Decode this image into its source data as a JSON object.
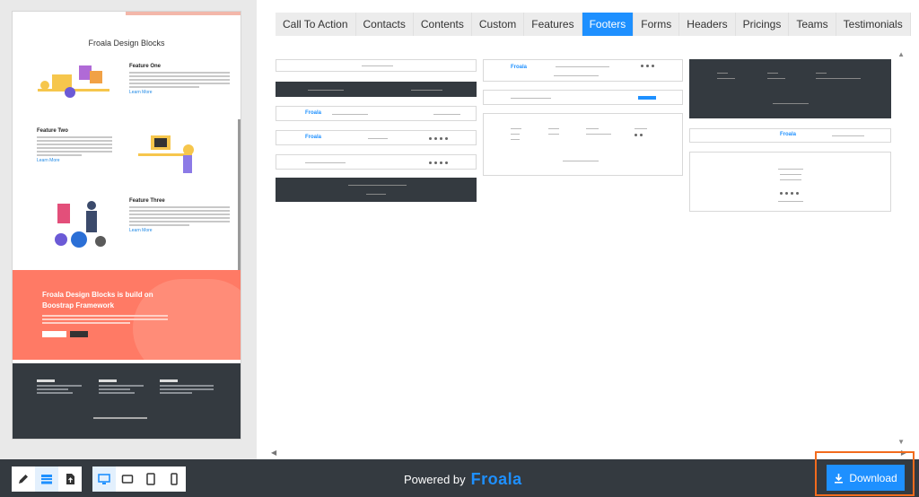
{
  "preview": {
    "title": "Froala Design Blocks",
    "features": [
      {
        "title": "Feature One",
        "link": "Learn More"
      },
      {
        "title": "Feature Two",
        "link": "Learn More"
      },
      {
        "title": "Feature Three",
        "link": "Learn More"
      }
    ],
    "cta_title": "Froala Design Blocks is build on Boostrap Framework",
    "footer_cols": [
      "Country A",
      "Country B",
      "About Us"
    ]
  },
  "tabs": [
    "Call To Action",
    "Contacts",
    "Contents",
    "Custom",
    "Features",
    "Footers",
    "Forms",
    "Headers",
    "Pricings",
    "Teams",
    "Testimonials"
  ],
  "active_tab": "Footers",
  "thumb_logo": "Froala",
  "bottom": {
    "powered_label": "Powered by",
    "brand": "Froala",
    "download_label": "Download"
  },
  "icons": {
    "edit": "pencil-icon",
    "blocks": "blocks-icon",
    "export": "file-export-icon",
    "desktop": "desktop-icon",
    "tablet_landscape": "tablet-landscape-icon",
    "tablet": "tablet-icon",
    "phone": "phone-icon",
    "download": "download-icon"
  }
}
